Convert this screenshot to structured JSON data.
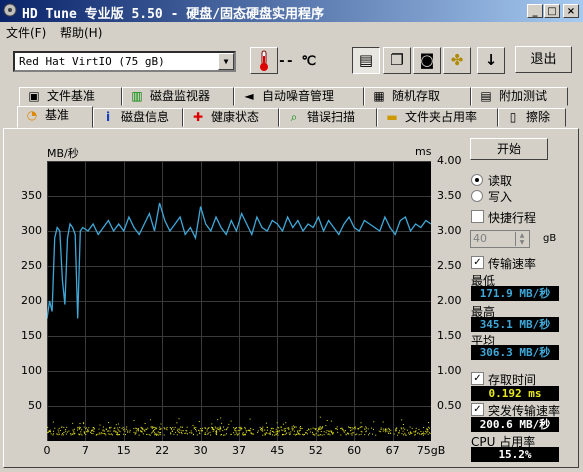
{
  "window": {
    "title": "HD Tune 专业版 5.50 - 硬盘/固态硬盘实用程序"
  },
  "menu": {
    "file": "文件(F)",
    "help": "帮助(H)"
  },
  "toolbar": {
    "drive": "Red Hat VirtIO (75 gB)",
    "temperature": "-- ℃",
    "exit_label": "退出",
    "icons": [
      "thermometer-icon",
      "copy-text-icon",
      "copy-icon",
      "camera-icon",
      "options-icon",
      "save-download-icon"
    ]
  },
  "tabs_top": [
    {
      "label": "文件基准",
      "icon": "file-benchmark-icon"
    },
    {
      "label": "磁盘监视器",
      "icon": "disk-monitor-icon"
    },
    {
      "label": "自动噪音管理",
      "icon": "speaker-icon"
    },
    {
      "label": "随机存取",
      "icon": "random-access-icon"
    },
    {
      "label": "附加测试",
      "icon": "extra-tests-icon"
    }
  ],
  "tabs_bottom": [
    {
      "label": "基准",
      "icon": "benchmark-icon",
      "active": true
    },
    {
      "label": "磁盘信息",
      "icon": "info-icon"
    },
    {
      "label": "健康状态",
      "icon": "health-icon"
    },
    {
      "label": "错误扫描",
      "icon": "error-scan-icon"
    },
    {
      "label": "文件夹占用率",
      "icon": "folder-usage-icon"
    },
    {
      "label": "擦除",
      "icon": "erase-icon"
    }
  ],
  "chart_data": {
    "type": "line",
    "left_unit": "MB/秒",
    "right_unit": "ms",
    "y_left_ticks": [
      "350",
      "300",
      "250",
      "200",
      "150",
      "100",
      "50"
    ],
    "y_right_ticks": [
      "4.00",
      "3.50",
      "3.00",
      "2.50",
      "2.00",
      "1.50",
      "1.00",
      "0.50"
    ],
    "x_ticks": [
      "0",
      "7",
      "15",
      "22",
      "30",
      "37",
      "45",
      "52",
      "60",
      "67",
      "75gB"
    ],
    "ylim_left": [
      0,
      400
    ],
    "ylim_right": [
      0,
      4.0
    ],
    "xlim": [
      0,
      75
    ],
    "series": [
      {
        "color": "#40a8d8",
        "x": [
          0,
          0.5,
          1,
          1.5,
          2,
          2.5,
          3,
          3.5,
          4,
          4.5,
          5,
          5.5,
          6,
          6.5,
          7,
          8,
          9,
          10,
          11,
          12,
          13,
          14,
          15,
          16,
          17,
          18,
          19,
          20,
          21,
          22,
          23,
          24,
          25,
          26,
          27,
          28,
          29,
          30,
          31,
          32,
          33,
          34,
          35,
          36,
          37,
          38,
          39,
          40,
          41,
          42,
          43,
          44,
          45,
          46,
          47,
          48,
          49,
          50,
          51,
          52,
          53,
          54,
          55,
          56,
          57,
          58,
          59,
          60,
          61,
          62,
          63,
          64,
          65,
          66,
          67,
          68,
          69,
          70,
          71,
          72,
          73,
          74,
          75
        ],
        "values": [
          175,
          200,
          185,
          290,
          305,
          300,
          230,
          195,
          290,
          310,
          305,
          295,
          175,
          300,
          305,
          300,
          310,
          295,
          305,
          315,
          300,
          310,
          300,
          320,
          305,
          295,
          310,
          325,
          300,
          340,
          315,
          300,
          310,
          320,
          295,
          305,
          290,
          335,
          310,
          300,
          320,
          305,
          295,
          315,
          300,
          325,
          310,
          295,
          320,
          305,
          300,
          315,
          310,
          300,
          320,
          305,
          315,
          300,
          310,
          305,
          320,
          300,
          315,
          305,
          295,
          310,
          320,
          305,
          300,
          315,
          310,
          305,
          300,
          320,
          305,
          295,
          315,
          320,
          300,
          310,
          305,
          315,
          310
        ]
      },
      {
        "color": "#e8e820",
        "x_start": 0,
        "x_end": 75,
        "y_approx": 0.15
      }
    ]
  },
  "right_panel": {
    "start_label": "开始",
    "read_label": "读取",
    "write_label": "写入",
    "short_stroke_label": "快捷行程",
    "short_stroke_value": "40",
    "short_stroke_unit": "gB",
    "transfer_rate_label": "传输速率",
    "min_label": "最低",
    "min_value": "171.9 MB/秒",
    "max_label": "最高",
    "max_value": "345.1 MB/秒",
    "avg_label": "平均",
    "avg_value": "306.3 MB/秒",
    "access_time_label": "存取时间",
    "access_time_value": "0.192 ms",
    "burst_rate_label": "突发传输速率",
    "burst_rate_value": "200.6 MB/秒",
    "cpu_label": "CPU 占用率",
    "cpu_value": "15.2%",
    "colors": {
      "min": "#40a8d8",
      "max": "#40a8d8",
      "avg": "#40a8d8",
      "access": "#e8e820",
      "burst": "#ffffff",
      "cpu": "#ffffff"
    }
  }
}
